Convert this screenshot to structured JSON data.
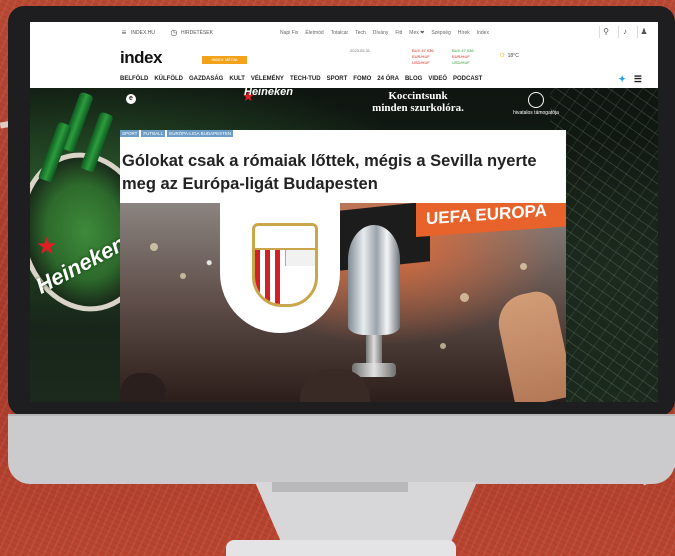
{
  "browser_page": {
    "topbar": {
      "left_label": "INDEX.HU",
      "left_icon": "menu-icon",
      "time_label": "HIRDETÉSEK",
      "nav_items": [
        "Napi Fix",
        "Életmód",
        "Totalcar",
        "Tech",
        "Dívány",
        "Fitt",
        "Mex ❤",
        "Szépség",
        "Hírek",
        "Index"
      ],
      "right_icons": [
        "search-icon",
        "bell-icon",
        "user-icon"
      ]
    },
    "logo": {
      "text": "index",
      "badge": "INDEX MÉDIA"
    },
    "ticker": {
      "date": "2023.05.31",
      "items": [
        "BUX 47 936",
        "EUR/HUF",
        "USD/HUF"
      ],
      "weather": "18°C"
    },
    "nav": {
      "items": [
        "BELFÖLD",
        "KÜLFÖLD",
        "GAZDASÁG",
        "KULT",
        "VÉLEMÉNY",
        "TECH-TUD",
        "SPORT",
        "FOMO",
        "24 ÓRA",
        "BLOG",
        "VIDEÓ",
        "PODCAST"
      ],
      "right_icons": [
        "twitter-icon",
        "menu-icon"
      ]
    },
    "ad": {
      "banner_line1": "Koccintsunk",
      "banner_line2": "minden szurkolóra.",
      "brand_small": "e",
      "brand": "Heineken",
      "sponsor_label": "hivatalos támogatója",
      "uel_label": "UEFA EUROPA LEAGUE"
    },
    "article": {
      "tags": [
        "SPORT",
        "FUTBALL",
        "EURÓPA-LIGA BUDAPESTEN"
      ],
      "headline": "Gólokat csak a rómaiak lőttek, mégis a Sevilla nyerte meg az Európa-ligát Budapesten",
      "photo_banner_text": "UEFA EUROPA"
    }
  }
}
